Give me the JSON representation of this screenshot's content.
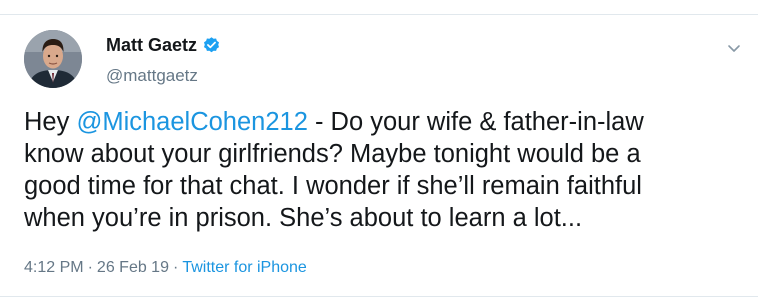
{
  "user": {
    "display_name": "Matt Gaetz",
    "handle": "@mattgaetz",
    "verified": true
  },
  "tweet": {
    "text_prefix": "Hey ",
    "mention": "@MichaelCohen212",
    "text_suffix": " - Do your wife & father-in-law\nknow about your girlfriends? Maybe tonight would be a\ngood time for that chat. I wonder if she’ll remain faithful\nwhen you’re in prison.  She’s about to learn a lot...",
    "time": "4:12 PM",
    "date": "26 Feb 19",
    "source": "Twitter for iPhone",
    "separator": "·"
  },
  "icons": {
    "verified": "verified-badge-icon",
    "menu": "chevron-down-icon"
  },
  "colors": {
    "link": "#1b95e0",
    "secondary_text": "#657786",
    "primary_text": "#14171a",
    "divider": "#e1e8ed"
  }
}
